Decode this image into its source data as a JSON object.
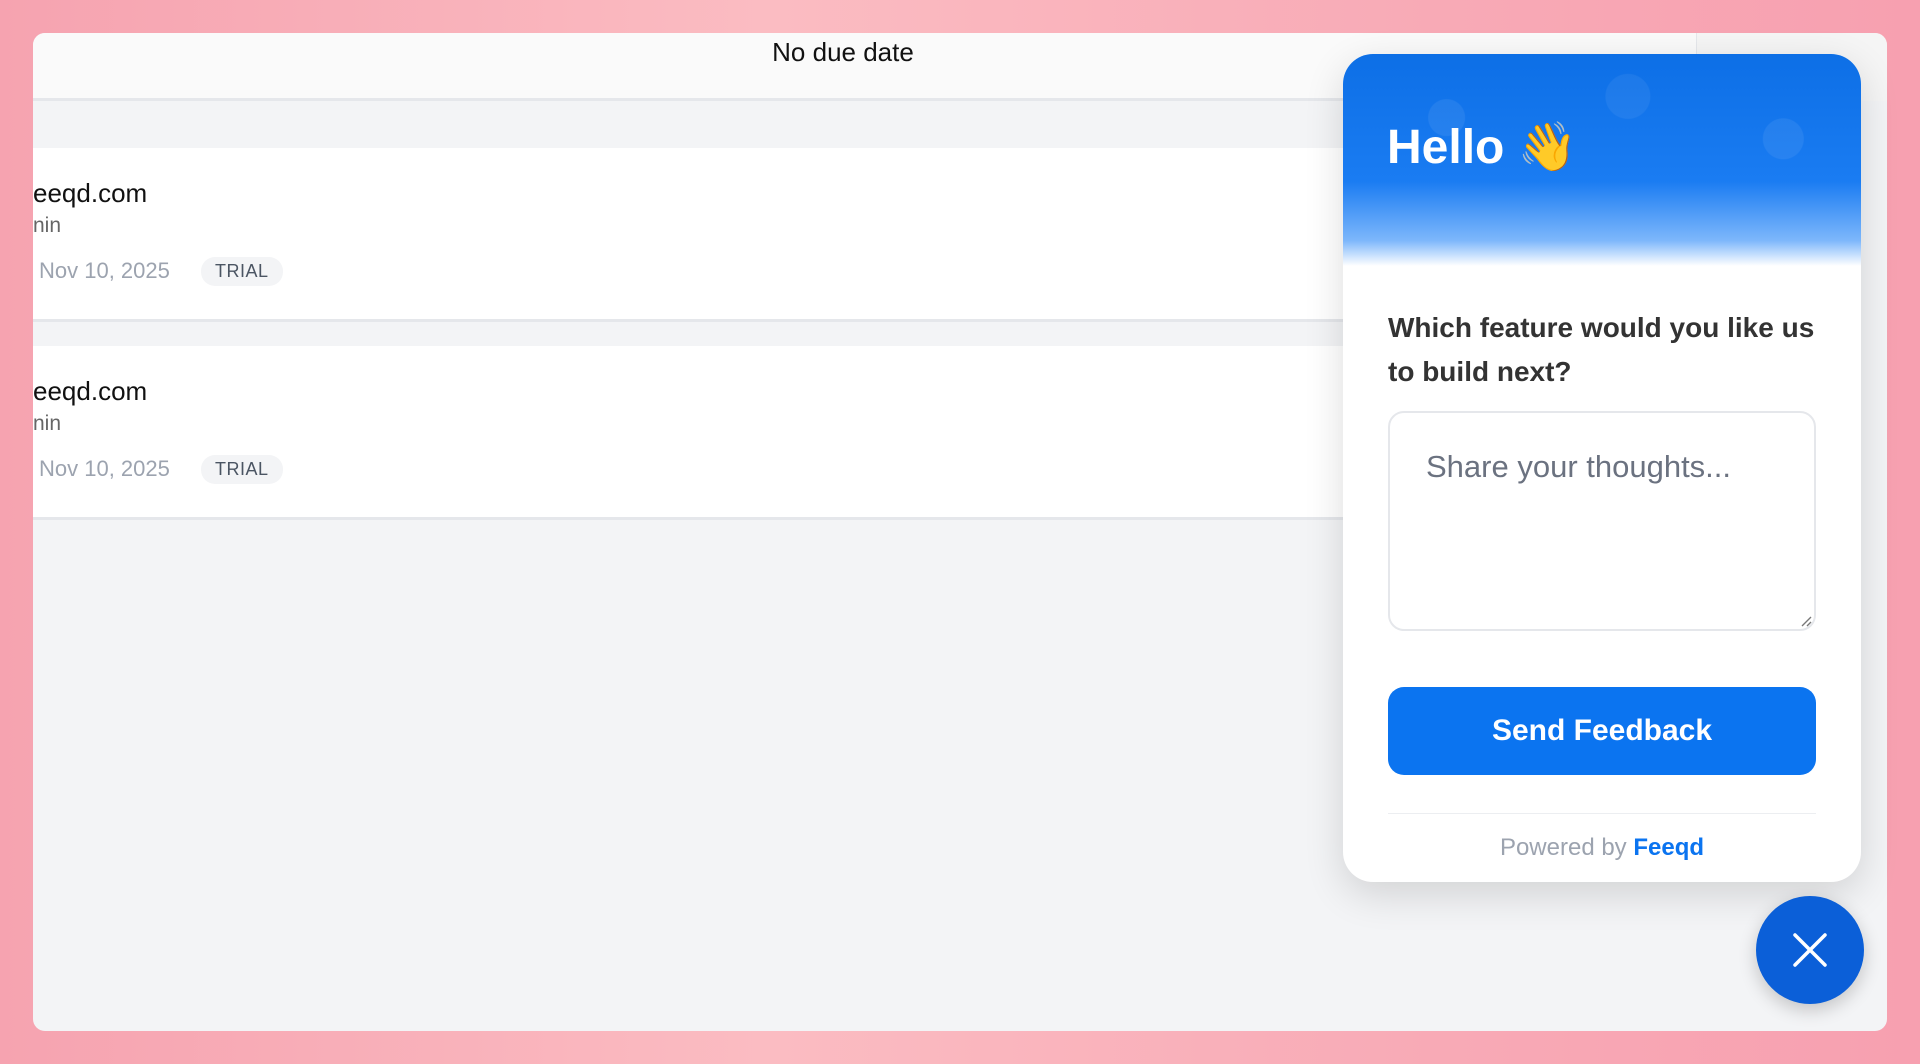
{
  "header": {
    "due_date": "No due date"
  },
  "cards": [
    {
      "domain": "eeqd.com",
      "role": "nin",
      "date": "Nov 10, 2025",
      "badge": "TRIAL"
    },
    {
      "domain": "eeqd.com",
      "role": "nin",
      "date": "Nov 10, 2025",
      "badge": "TRIAL"
    }
  ],
  "widget": {
    "greeting": "Hello 👋",
    "question": "Which feature would you like us to build next?",
    "input_placeholder": "Share your thoughts...",
    "submit_label": "Send Feedback",
    "powered_prefix": "Powered by",
    "powered_brand": "Feeqd",
    "accent_color": "#0b74f0"
  },
  "icons": {
    "close": "close-icon",
    "resize": "resize-grip-icon"
  }
}
